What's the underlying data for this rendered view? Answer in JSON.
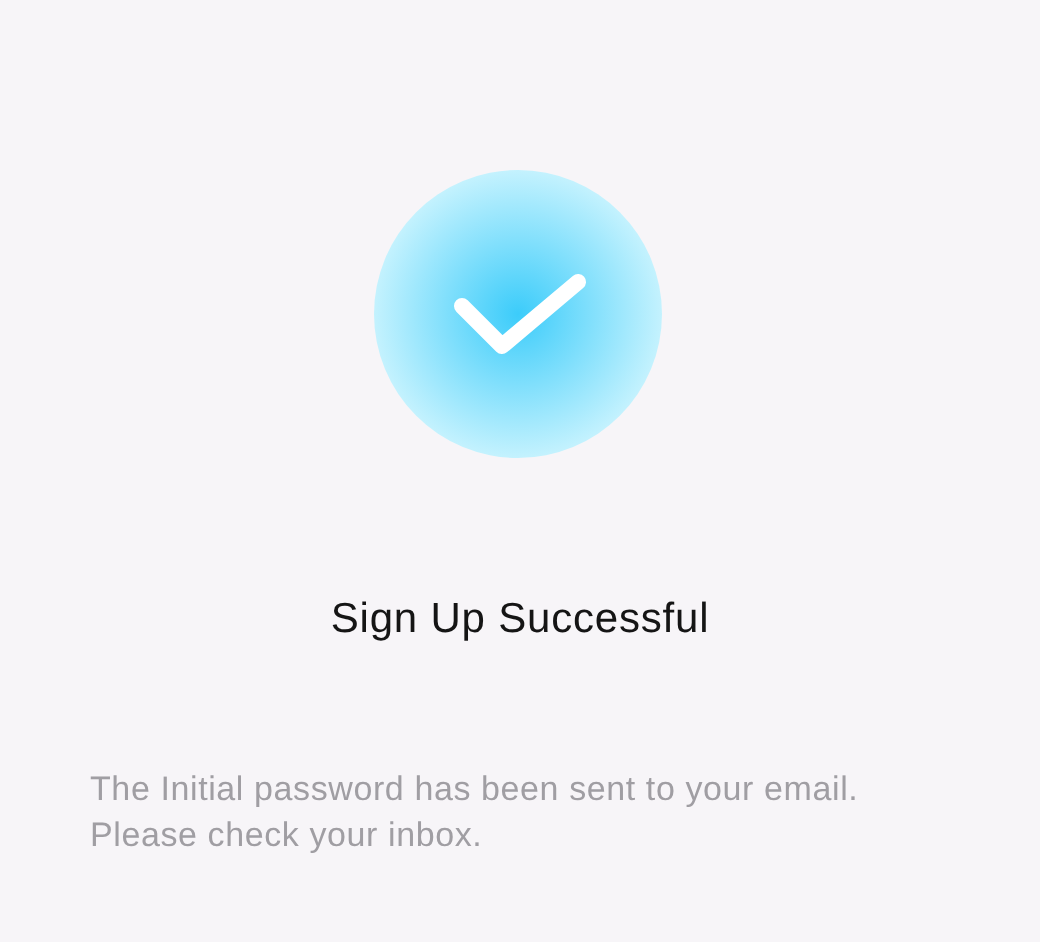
{
  "title": "Sign Up Successful",
  "message": "The Initial password has been sent to your email. Please check your inbox."
}
